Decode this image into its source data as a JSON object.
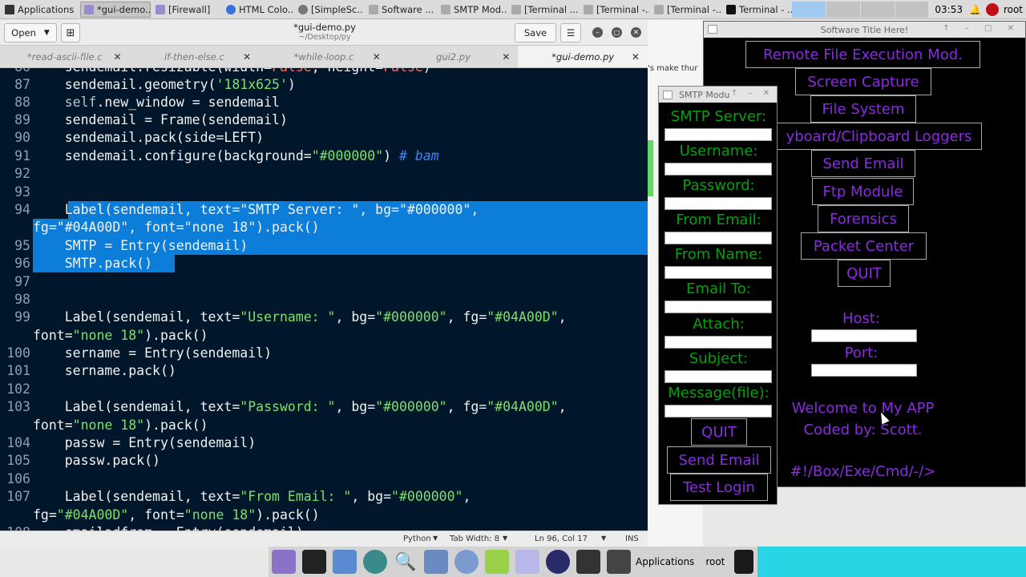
{
  "taskbar": {
    "apps_label": "Applications",
    "tasks": [
      {
        "label": "*gui-demo...",
        "active": true
      },
      {
        "label": "[Firewall]",
        "active": false
      },
      {
        "label": "HTML Colo...",
        "active": false
      },
      {
        "label": "[SimpleSc...",
        "active": false
      },
      {
        "label": "Software ...",
        "active": false
      },
      {
        "label": "SMTP Mod...",
        "active": false
      },
      {
        "label": "[Terminal ...",
        "active": false
      },
      {
        "label": "[Terminal -...",
        "active": false
      },
      {
        "label": "[Terminal -...",
        "active": false
      },
      {
        "label": "Terminal - ...",
        "active": false
      }
    ],
    "clock": "03:53",
    "user": "root"
  },
  "editor": {
    "open_label": "Open",
    "title": "*gui-demo.py",
    "path": "~/Desktop/py",
    "save_label": "Save",
    "tabs": [
      "*read-ascii-file.c",
      "if-then-else.c",
      "*while-loop.c",
      "gui2.py",
      "*gui-demo.py"
    ],
    "status": {
      "lang": "Python",
      "tab_width": "Tab Width: 8",
      "position": "Ln 96, Col 17",
      "mode": "INS"
    }
  },
  "bg_snippet": "'s make thur",
  "software_window": {
    "title": "Software Title Here!",
    "buttons": [
      "Remote File Execution Mod.",
      "Screen Capture",
      "File System",
      "yboard/Clipboard Loggers",
      "Send Email",
      "Ftp Module",
      "Forensics",
      "Packet Center",
      "QUIT"
    ],
    "host_label": "Host:",
    "port_label": "Port:",
    "welcome": "Welcome to My APP",
    "coded_by": "Coded by: Scott.",
    "footer": "#!/Box/Exe/Cmd/-/>"
  },
  "smtp_window": {
    "title": "SMTP Modu",
    "fields": [
      "SMTP Server:",
      "Username:",
      "Password:",
      "From Email:",
      "From Name:",
      "Email To:",
      "Attach:",
      "Subject:",
      "Message(file):"
    ],
    "quit_label": "QUIT",
    "send_label": "Send Email",
    "test_label": "Test Login"
  },
  "dock": {
    "apps_label": "Applications",
    "user": "root"
  },
  "colors": {
    "code_bg": "#00162a",
    "selection": "#0c7dd8",
    "string_green": "#7ee06a",
    "app_purple": "#8a2be2",
    "smtp_green": "#04A00D",
    "dock_cyan": "#27d5e4"
  }
}
